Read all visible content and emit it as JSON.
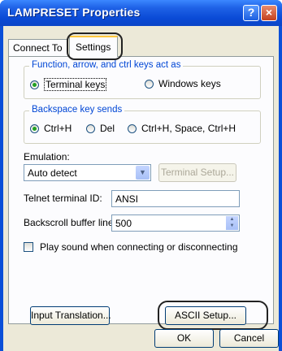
{
  "window": {
    "title": "LAMPRESET Properties",
    "help_glyph": "?",
    "close_glyph": "×"
  },
  "tabs": [
    {
      "label": "Connect To"
    },
    {
      "label": "Settings"
    }
  ],
  "keys_group": {
    "label": "Function, arrow, and ctrl keys act as",
    "options": [
      {
        "label": "Terminal keys",
        "selected": true
      },
      {
        "label": "Windows keys",
        "selected": false
      }
    ]
  },
  "backspace_group": {
    "label": "Backspace key sends",
    "options": [
      {
        "label": "Ctrl+H",
        "selected": true
      },
      {
        "label": "Del",
        "selected": false
      },
      {
        "label": "Ctrl+H, Space, Ctrl+H",
        "selected": false
      }
    ]
  },
  "emulation": {
    "label": "Emulation:",
    "value": "Auto detect",
    "setup_button": "Terminal Setup..."
  },
  "telnet": {
    "label": "Telnet terminal ID:",
    "value": "ANSI"
  },
  "backscroll": {
    "label": "Backscroll buffer lines:",
    "value": "500"
  },
  "play_sound": {
    "label": "Play sound when connecting or disconnecting",
    "checked": false
  },
  "buttons": {
    "input_translation": "Input Translation...",
    "ascii_setup": "ASCII Setup...",
    "ok": "OK",
    "cancel": "Cancel"
  },
  "colors": {
    "title_bar": "#0a4ad6",
    "dialog_bg": "#ece9d8",
    "group_label": "#0046d5",
    "radio_selected": "#21a121"
  }
}
